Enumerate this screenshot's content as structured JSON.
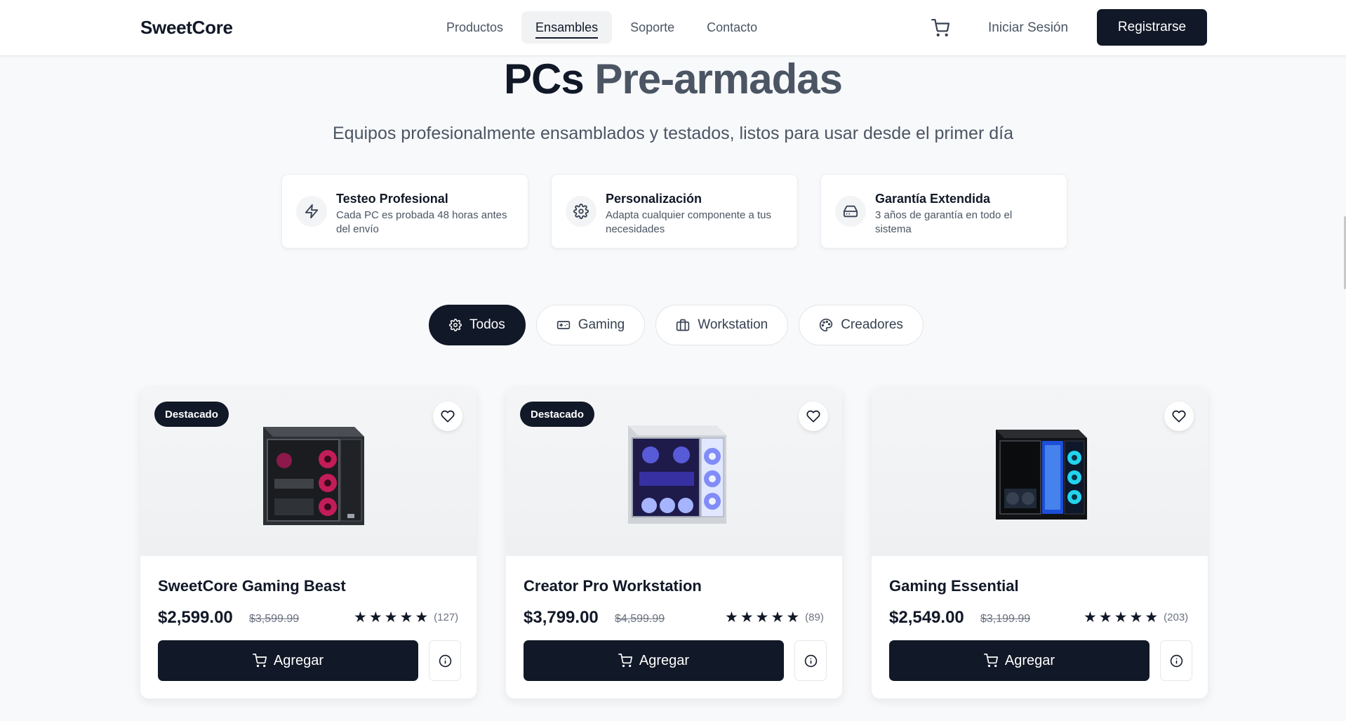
{
  "header": {
    "brand": "SweetCore",
    "nav": [
      {
        "label": "Productos",
        "active": false
      },
      {
        "label": "Ensambles",
        "active": true
      },
      {
        "label": "Soporte",
        "active": false
      },
      {
        "label": "Contacto",
        "active": false
      }
    ],
    "cart_icon": "cart-icon",
    "login_label": "Iniciar Sesión",
    "register_label": "Registrarse"
  },
  "hero": {
    "title_main": "PCs ",
    "title_accent": "Pre-armadas",
    "subtitle": "Equipos profesionalmente ensamblados y testados, listos para usar desde el primer día"
  },
  "features": [
    {
      "icon": "zap-icon",
      "title": "Testeo Profesional",
      "desc": "Cada PC es probada 48 horas antes del envío"
    },
    {
      "icon": "gear-icon",
      "title": "Personalización",
      "desc": "Adapta cualquier componente a tus necesidades"
    },
    {
      "icon": "hard-drive-icon",
      "title": "Garantía Extendida",
      "desc": "3 años de garantía en todo el sistema"
    }
  ],
  "filters": [
    {
      "icon": "gear-icon",
      "label": "Todos",
      "active": true
    },
    {
      "icon": "gamepad-icon",
      "label": "Gaming",
      "active": false
    },
    {
      "icon": "briefcase-icon",
      "label": "Workstation",
      "active": false
    },
    {
      "icon": "palette-icon",
      "label": "Creadores",
      "active": false
    }
  ],
  "products": [
    {
      "badge": "Destacado",
      "name": "SweetCore Gaming Beast",
      "price": "$2,599.00",
      "old_price": "$3,599.99",
      "rating": 5,
      "reviews": "(127)",
      "add_label": "Agregar",
      "case_theme": "red"
    },
    {
      "badge": "Destacado",
      "name": "Creator Pro Workstation",
      "price": "$3,799.00",
      "old_price": "$4,599.99",
      "rating": 5,
      "reviews": "(89)",
      "add_label": "Agregar",
      "case_theme": "blue-white"
    },
    {
      "badge": "",
      "name": "Gaming Essential",
      "price": "$2,549.00",
      "old_price": "$3,199.99",
      "rating": 5,
      "reviews": "(203)",
      "add_label": "Agregar",
      "case_theme": "cyan-black"
    }
  ],
  "colors": {
    "primary": "#111827",
    "text_muted": "#4b5563",
    "background": "#f8f9fb"
  }
}
